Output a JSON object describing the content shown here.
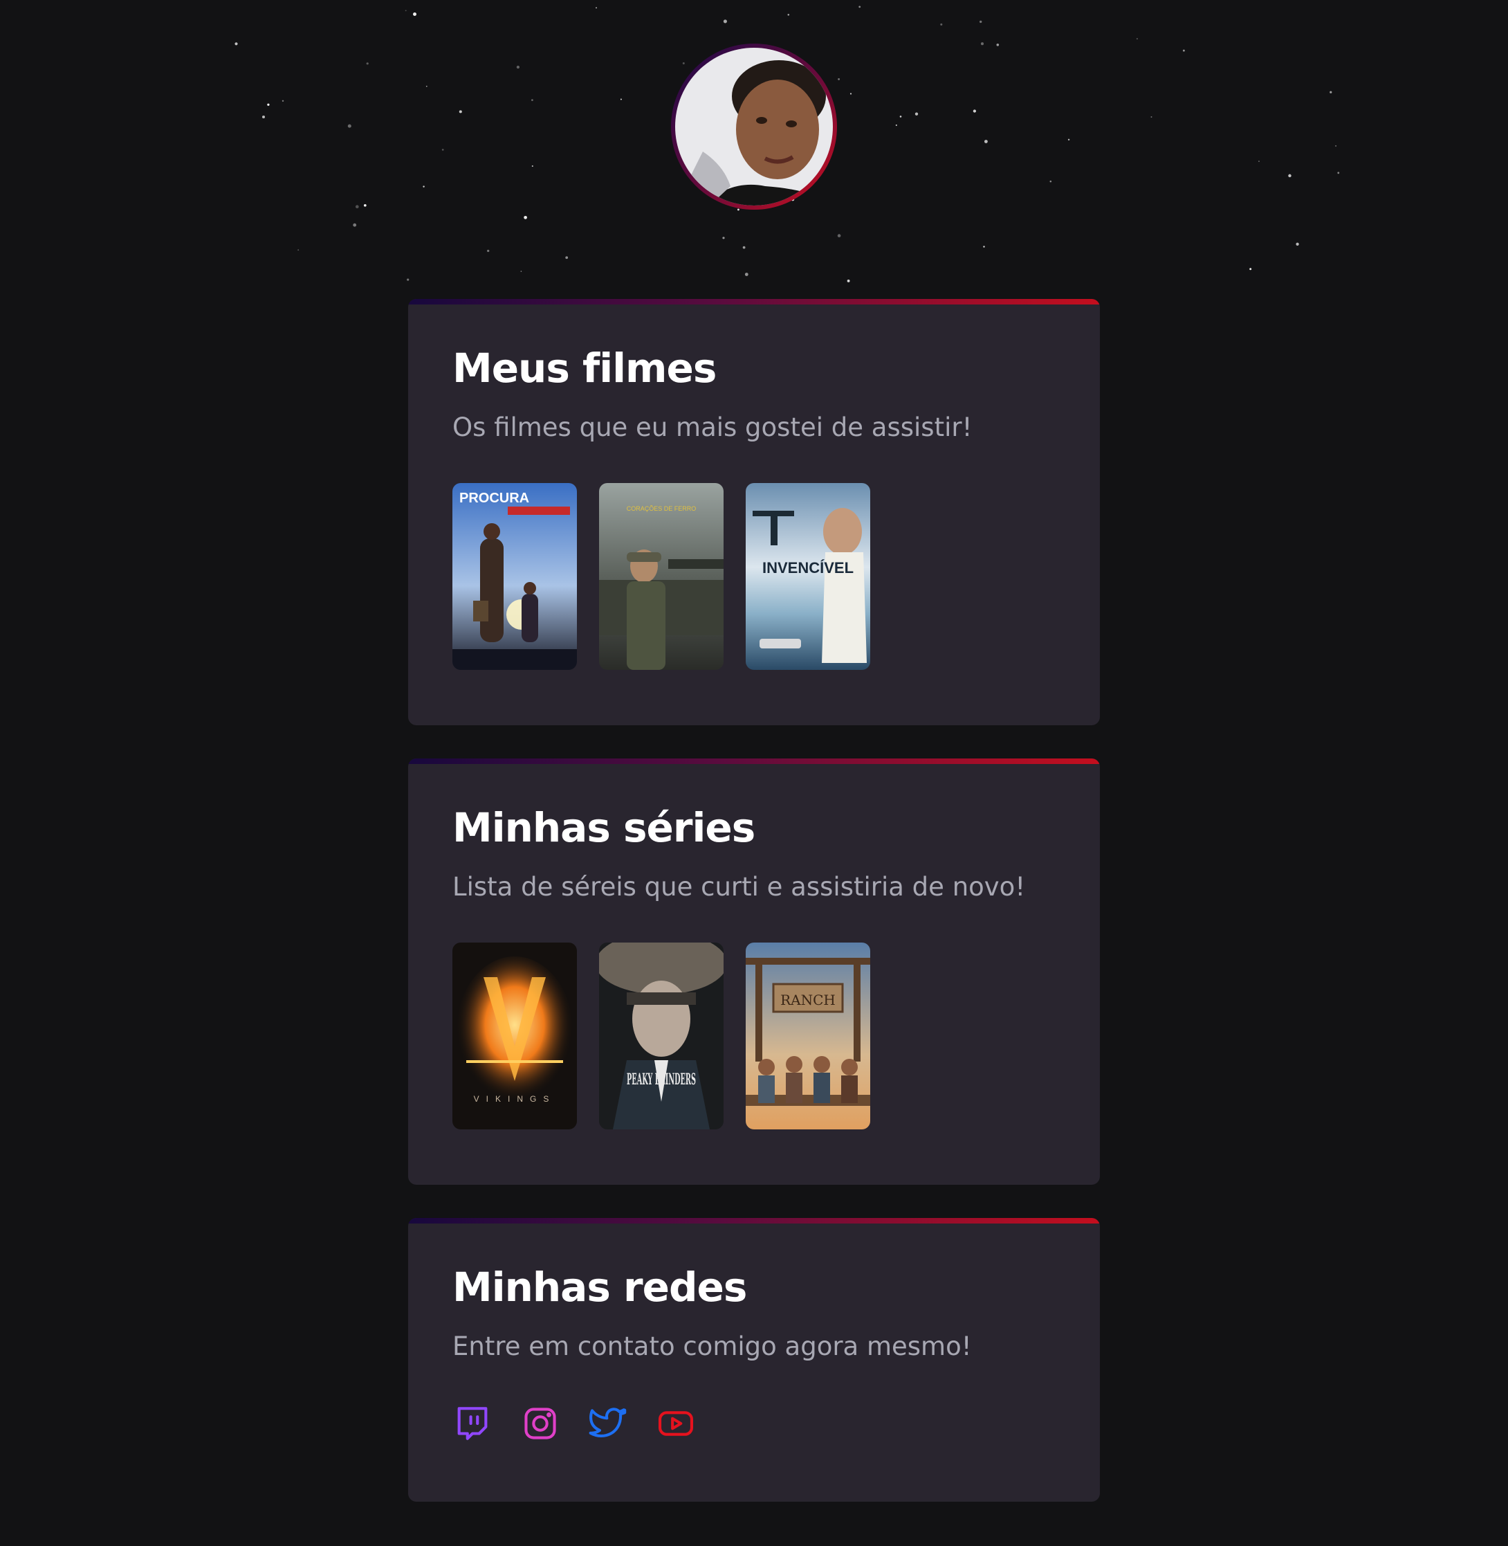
{
  "profile": {
    "avatar_icon": "profile-photo"
  },
  "sections": [
    {
      "title": "Meus filmes",
      "subtitle": "Os filmes que eu mais gostei de assistir!",
      "items": [
        {
          "icon": "poster-a-procura-da-felicidade",
          "text": "PROCURA"
        },
        {
          "icon": "poster-coracoes-de-ferro",
          "text": "CORAÇÕES DE FERRO"
        },
        {
          "icon": "poster-invencivel",
          "text": "INVENCÍVEL"
        }
      ]
    },
    {
      "title": "Minhas séries",
      "subtitle": "Lista de séreis que curti e assistiria de novo!",
      "items": [
        {
          "icon": "poster-vikings",
          "text": "VIKINGS"
        },
        {
          "icon": "poster-peaky-blinders",
          "text": "PEAKY BLINDERS"
        },
        {
          "icon": "poster-the-ranch",
          "text": "RANCH"
        }
      ]
    },
    {
      "title": "Minhas redes",
      "subtitle": "Entre em contato comigo agora mesmo!",
      "socials": [
        {
          "icon": "twitch-icon",
          "color": "#9147ff"
        },
        {
          "icon": "instagram-icon",
          "color": "#e040c8"
        },
        {
          "icon": "twitter-icon",
          "color": "#1d6ff2"
        },
        {
          "icon": "youtube-icon",
          "color": "#e5121e"
        }
      ]
    }
  ],
  "colors": {
    "background": "#121214",
    "card": "#29252f",
    "accent_start": "#17083d",
    "accent_end": "#c40e1e",
    "subtitle": "#a8a8b3"
  }
}
